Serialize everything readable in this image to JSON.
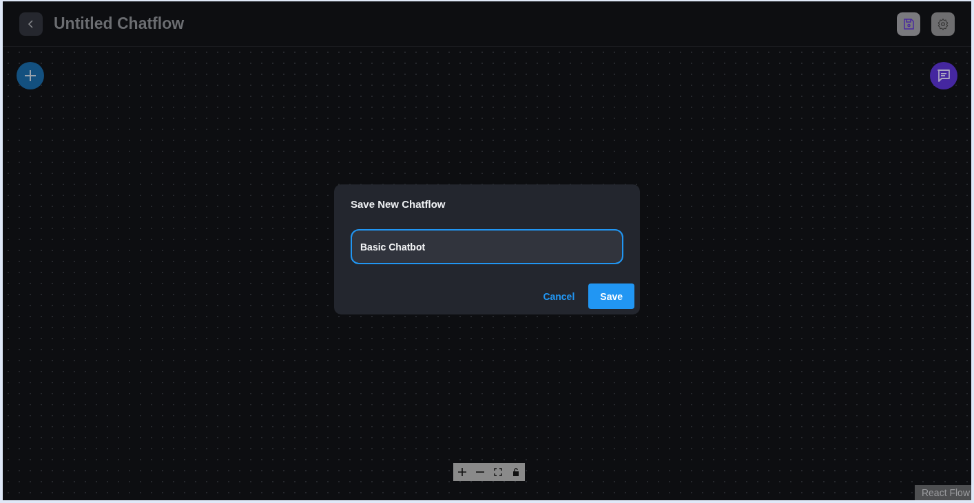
{
  "header": {
    "title": "Untitled Chatflow"
  },
  "dialog": {
    "title": "Save New Chatflow",
    "field": {
      "value": "Basic Chatbot",
      "focused": true
    },
    "buttons": [
      {
        "label": "Cancel",
        "kind": "text"
      },
      {
        "label": "Save",
        "kind": "contained"
      }
    ]
  },
  "attribution": "React Flow"
}
